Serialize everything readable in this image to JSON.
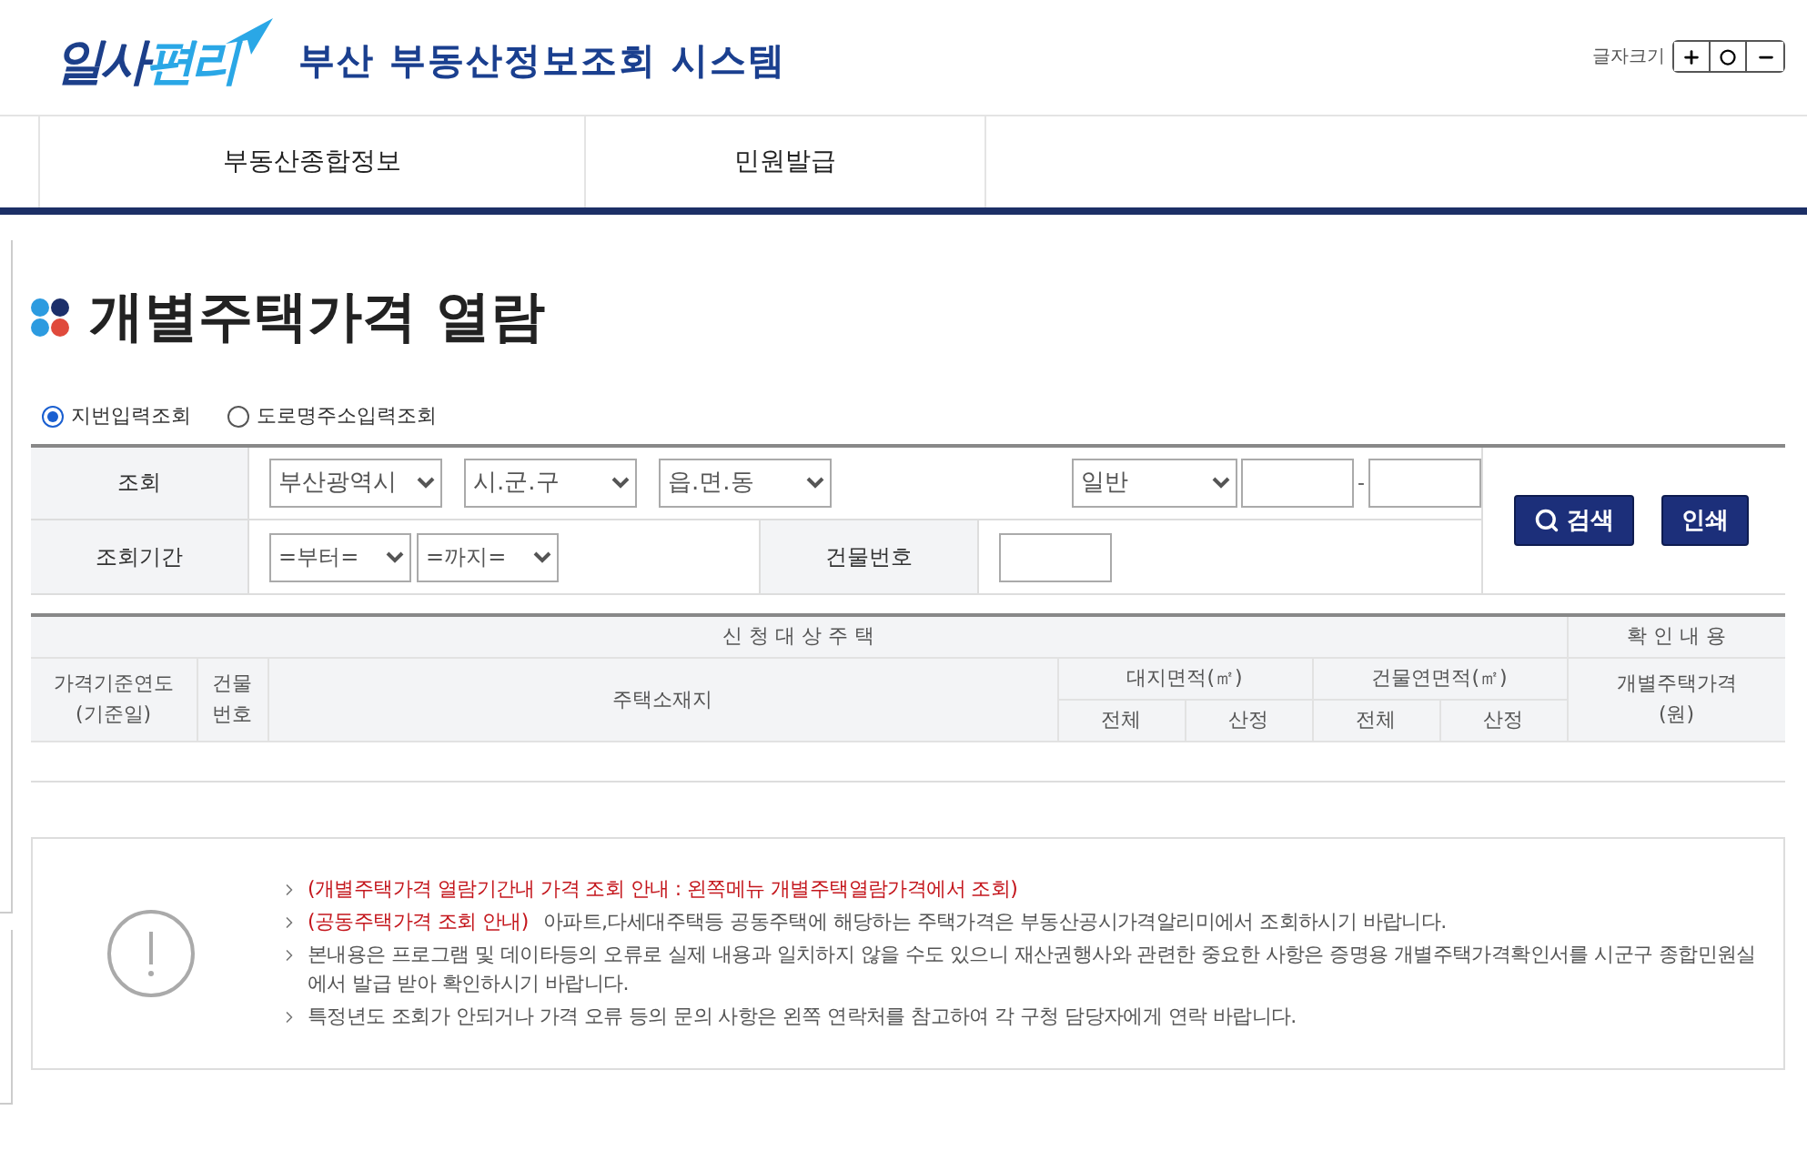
{
  "header": {
    "logo": [
      "일사",
      "편리"
    ],
    "system_title": "부산 부동산정보조회 시스템",
    "font_size_label": "글자크기"
  },
  "nav": [
    "부동산종합정보",
    "민원발급"
  ],
  "page_title": "개별주택가격 열람",
  "search_modes": [
    {
      "label": "지번입력조회",
      "selected": true
    },
    {
      "label": "도로명주소입력조회",
      "selected": false
    }
  ],
  "search_form": {
    "row_1": {
      "label": "조회",
      "selects": [
        "부산광역시",
        "시.군.구",
        "읍.면.동"
      ],
      "type_select": "일반",
      "separator": "-"
    },
    "row_2": {
      "label": "조회기간",
      "selects": [
        "=부터=",
        "=까지="
      ],
      "building_label": "건물번호"
    },
    "buttons": [
      {
        "label": "검색",
        "kind": "search"
      },
      {
        "label": "인쇄",
        "kind": "plain"
      }
    ]
  },
  "result_table": {
    "applicant_group": "신 청 대 상 주 택",
    "confirm_group": "확 인 내 용",
    "base_year": "가격기준연도\n(기준일)",
    "building_no": "건물\n번호",
    "address": "주택소재지",
    "land_area": {
      "label": "대지면적(㎡)",
      "sub": [
        "전체",
        "산정"
      ]
    },
    "building_area": {
      "label": "건물연면적(㎡)",
      "sub": [
        "전체",
        "산정"
      ]
    },
    "price": "개별주택가격\n(원)"
  },
  "notices": [
    {
      "highlight": "(개별주택가격 열람기간내 가격 조회 안내 : 왼쪽메뉴 개별주택열람가격에서 조회)"
    },
    {
      "highlight": "(공동주택가격 조회 안내)",
      "text": "아파트,다세대주택등 공동주택에 해당하는 주택가격은 부동산공시가격알리미에서 조회하시기 바랍니다."
    },
    {
      "text": "본내용은 프로그램 및 데이타등의 오류로 실제 내용과 일치하지 않을 수도 있으니 재산권행사와 관련한 중요한 사항은 증명용 개별주택가격확인서를 시군구 종합민원실에서 발급 받아 확인하시기 바랍니다."
    },
    {
      "text": "특정년도 조회가 안되거나 가격 오류 등의 문의 사항은 왼쪽 연락처를 참고하여 각 구청 담당자에게 연락 바랍니다."
    }
  ]
}
